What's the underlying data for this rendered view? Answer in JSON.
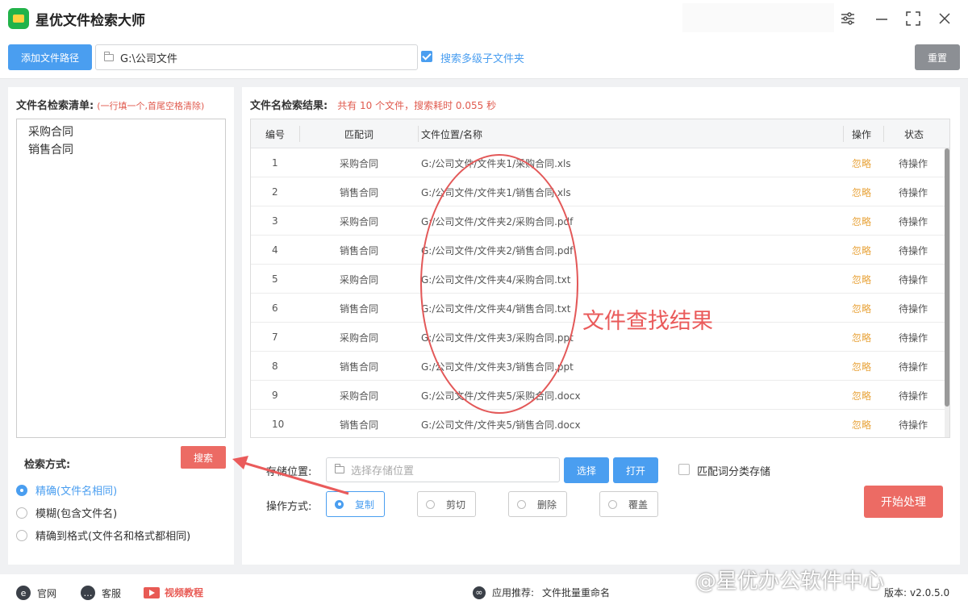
{
  "app": {
    "title": "星优文件检索大师"
  },
  "window": {
    "settings_icon": "sliders-icon",
    "minimize_icon": "minimize-icon",
    "maximize_icon": "maximize-icon",
    "close_icon": "close-icon"
  },
  "toolbar": {
    "add_path_label": "添加文件路径",
    "path_value": "G:\\公司文件",
    "subfolder_label": "搜索多级子文件夹",
    "subfolder_checked": true,
    "reset_label": "重置"
  },
  "left": {
    "list_title": "文件名检索清单:",
    "list_hint": "(一行填一个,首尾空格清除)",
    "keywords": [
      "采购合同",
      "销售合同"
    ],
    "search_label": "搜索",
    "mode_title": "检索方式:",
    "modes": [
      {
        "label": "精确(文件名相同)",
        "selected": true
      },
      {
        "label": "模糊(包含文件名)",
        "selected": false
      },
      {
        "label": "精确到格式(文件名和格式都相同)",
        "selected": false
      }
    ]
  },
  "results": {
    "title": "文件名检索结果:",
    "summary": "共有 10 个文件，搜索耗时 0.055 秒",
    "columns": [
      "编号",
      "匹配词",
      "文件位置/名称",
      "操作",
      "状态"
    ],
    "rows": [
      {
        "id": "1",
        "keyword": "采购合同",
        "path": "G:/公司文件/文件夹1/采购合同.xls",
        "action": "忽略",
        "status": "待操作"
      },
      {
        "id": "2",
        "keyword": "销售合同",
        "path": "G:/公司文件/文件夹1/销售合同.xls",
        "action": "忽略",
        "status": "待操作"
      },
      {
        "id": "3",
        "keyword": "采购合同",
        "path": "G:/公司文件/文件夹2/采购合同.pdf",
        "action": "忽略",
        "status": "待操作"
      },
      {
        "id": "4",
        "keyword": "销售合同",
        "path": "G:/公司文件/文件夹2/销售合同.pdf",
        "action": "忽略",
        "status": "待操作"
      },
      {
        "id": "5",
        "keyword": "采购合同",
        "path": "G:/公司文件/文件夹4/采购合同.txt",
        "action": "忽略",
        "status": "待操作"
      },
      {
        "id": "6",
        "keyword": "销售合同",
        "path": "G:/公司文件/文件夹4/销售合同.txt",
        "action": "忽略",
        "status": "待操作"
      },
      {
        "id": "7",
        "keyword": "采购合同",
        "path": "G:/公司文件/文件夹3/采购合同.ppt",
        "action": "忽略",
        "status": "待操作"
      },
      {
        "id": "8",
        "keyword": "销售合同",
        "path": "G:/公司文件/文件夹3/销售合同.ppt",
        "action": "忽略",
        "status": "待操作"
      },
      {
        "id": "9",
        "keyword": "采购合同",
        "path": "G:/公司文件/文件夹5/采购合同.docx",
        "action": "忽略",
        "status": "待操作"
      },
      {
        "id": "10",
        "keyword": "销售合同",
        "path": "G:/公司文件/文件夹5/销售合同.docx",
        "action": "忽略",
        "status": "待操作"
      }
    ]
  },
  "annotation": {
    "text": "文件查找结果",
    "color": "#ea5b5b"
  },
  "storage": {
    "label": "存储位置:",
    "placeholder": "选择存储位置",
    "choose_label": "选择",
    "open_label": "打开",
    "classify_label": "匹配词分类存储",
    "classify_checked": false
  },
  "operation": {
    "label": "操作方式:",
    "options": [
      {
        "label": "复制",
        "selected": true
      },
      {
        "label": "剪切",
        "selected": false
      },
      {
        "label": "删除",
        "selected": false
      },
      {
        "label": "覆盖",
        "selected": false
      }
    ],
    "start_label": "开始处理"
  },
  "statusbar": {
    "website_label": "官网",
    "service_label": "客服",
    "video_label": "视频教程",
    "recommend_label": "应用推荐:",
    "recommend_app": "文件批量重命名",
    "version_label": "版本:",
    "version_value": "v2.0.5.0"
  },
  "watermark": "@星优办公软件中心",
  "colors": {
    "primary": "#4a9ef0",
    "danger": "#ec6b64",
    "ignore": "#e8a33a"
  }
}
